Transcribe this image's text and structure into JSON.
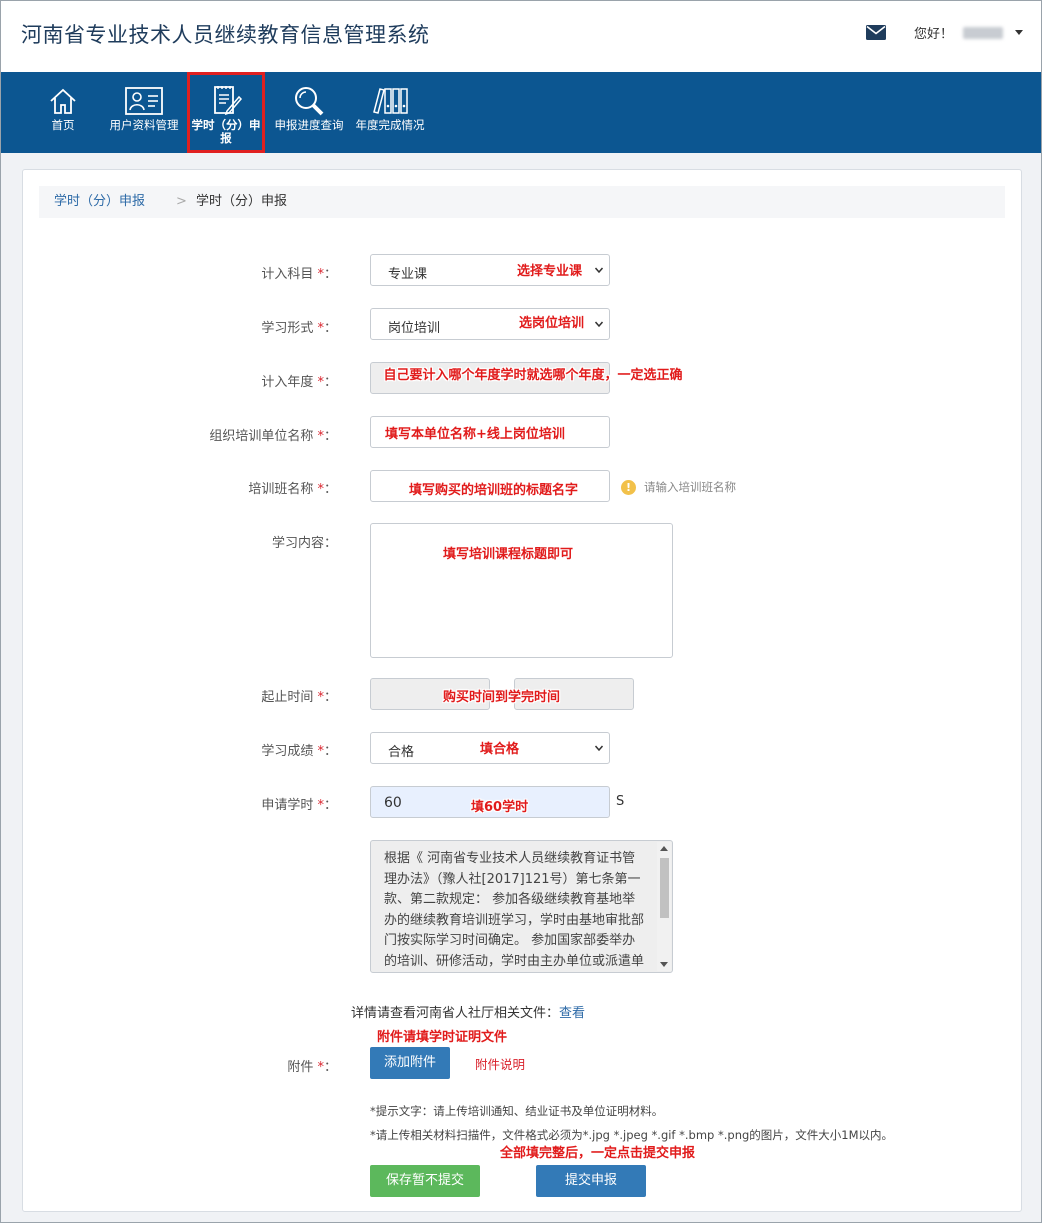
{
  "header": {
    "title": "河南省专业技术人员继续教育信息管理系统",
    "greeting": "您好！"
  },
  "nav": {
    "items": [
      {
        "label": "首页",
        "icon": "home-icon"
      },
      {
        "label": "用户资料管理",
        "icon": "user-card-icon"
      },
      {
        "label": "学时（分）申报",
        "icon": "document-edit-icon",
        "active": true
      },
      {
        "label": "申报进度查询",
        "icon": "magnifier-icon"
      },
      {
        "label": "年度完成情况",
        "icon": "binders-icon"
      }
    ]
  },
  "breadcrumb": {
    "parent": "学时（分）申报",
    "separator": ">",
    "current": "学时（分）申报"
  },
  "form": {
    "required_mark": "*",
    "subject_label": "计入科目",
    "subject_value": "专业课",
    "form_label": "学习形式",
    "form_value": "岗位培训",
    "year_label": "计入年度",
    "org_label": "组织培训单位名称",
    "class_label": "培训班名称",
    "class_hint": "请输入培训班名称",
    "content_label": "学习内容",
    "period_label": "起止时间",
    "score_label": "学习成绩",
    "score_value": "合格",
    "hours_label": "申请学时",
    "hours_value": "60",
    "hours_unit": "S",
    "policy_text": "根据《 河南省专业技术人员继续教育证书管理办法》（豫人社[2017]121号）第七条第一款、第二款规定： 参加各级继续教育基地举办的继续教育培训班学习，学时由基地审批部门按实际学习时间确定。 参加国家部委举办的培训、研修活动，学时由主办单位或派遣单位按实际学习时间确定。",
    "details_text": "详情请查看河南省人社厅相关文件：",
    "details_link": "查看",
    "attach_label": "附件",
    "attach_button": "添加附件",
    "attach_note": "附件说明",
    "tip1": "*提示文字：请上传培训通知、结业证书及单位证明材料。",
    "tip2": "*请上传相关材料扫描件，文件格式必须为*.jpg *.jpeg *.gif *.bmp *.png的图片，文件大小1M以内。",
    "save_button": "保存暂不提交",
    "submit_button": "提交申报"
  },
  "annotations": {
    "subject": "选择专业课",
    "form": "选岗位培训",
    "year": "自己要计入哪个年度学时就选哪个年度，一定选正确",
    "org": "填写本单位名称+线上岗位培训",
    "class": "填写购买的培训班的标题名字",
    "content": "填写培训课程标题即可",
    "period": "购买时间到学完时间",
    "score": "填合格",
    "hours": "填60学时",
    "attach": "附件请填学时证明文件",
    "submit": "全部填完整后，一定点击提交申报"
  },
  "colors": {
    "nav_bg": "#0c5691",
    "title": "#1f3c5c",
    "annotation": "#e11b1b",
    "primary_button": "#337ab7",
    "success_button": "#5cb85c"
  }
}
